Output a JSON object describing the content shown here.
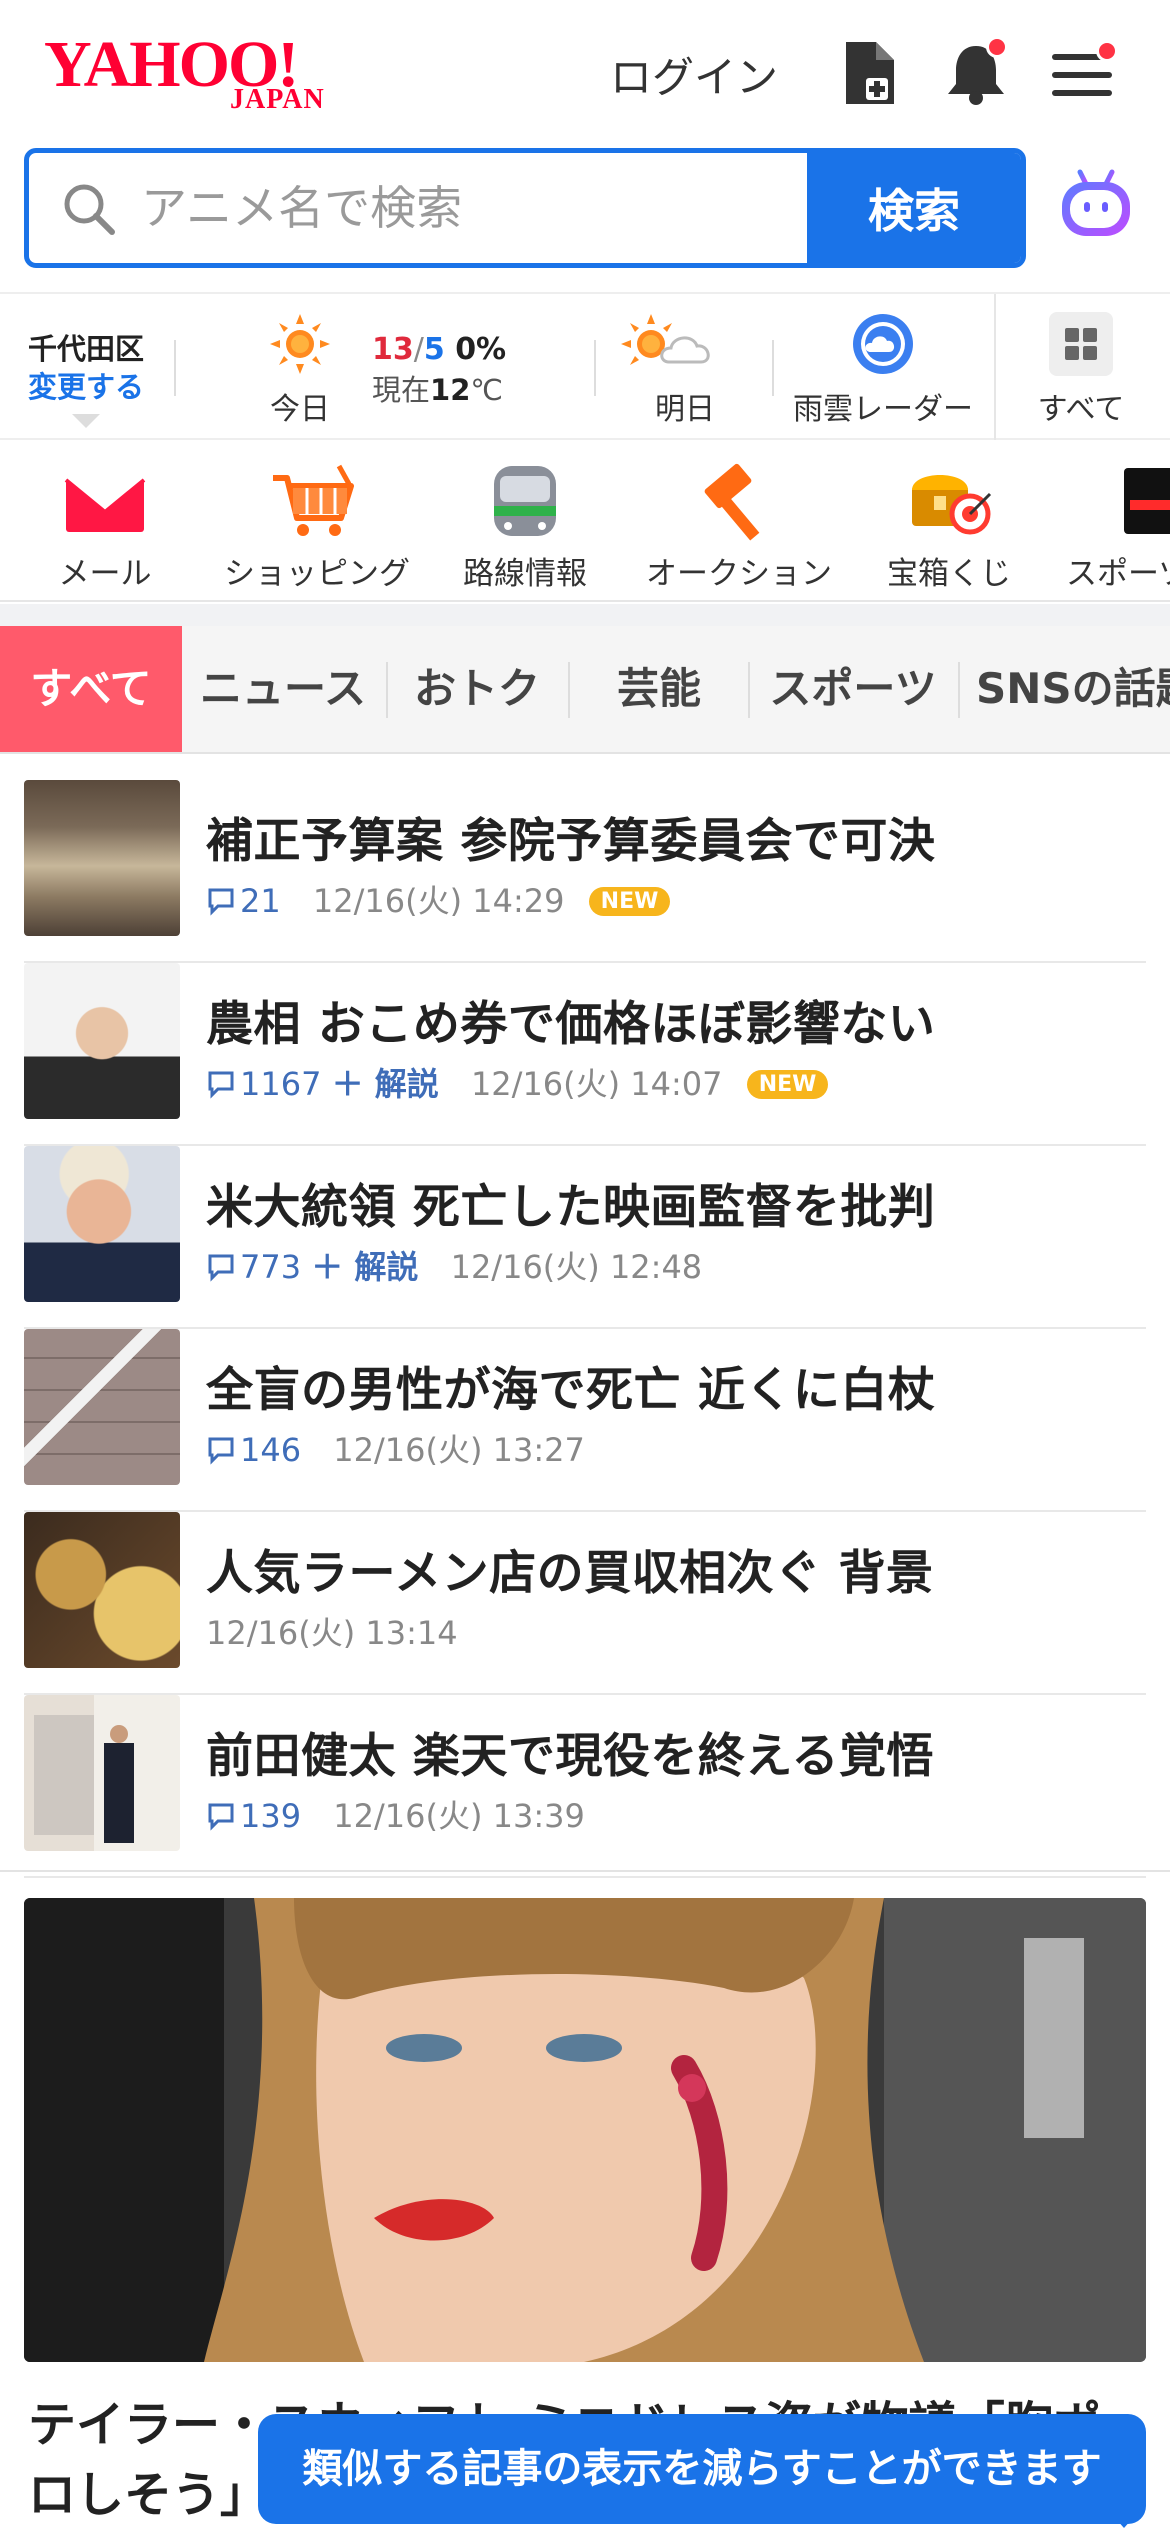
{
  "header": {
    "logo_main": "YAHOO!",
    "logo_sub": "JAPAN",
    "login_label": "ログイン"
  },
  "search": {
    "placeholder": "アニメ名で検索",
    "button_label": "検索"
  },
  "weather": {
    "location": "千代田区",
    "change_label": "変更する",
    "today_label": "今日",
    "high": "13",
    "low": "5",
    "precip": "0%",
    "now_prefix": "現在",
    "now_temp": "12",
    "now_unit": "℃",
    "tomorrow_label": "明日",
    "radar_label": "雨雲レーダー",
    "all_label": "すべて"
  },
  "services": [
    {
      "label": "メール",
      "icon": "mail-icon"
    },
    {
      "label": "ショッピング",
      "icon": "cart-icon"
    },
    {
      "label": "路線情報",
      "icon": "train-icon"
    },
    {
      "label": "オークション",
      "icon": "auction-hammer-icon"
    },
    {
      "label": "宝箱くじ",
      "icon": "treasure-box-icon"
    },
    {
      "label": "スポーツ",
      "icon": "sports-icon"
    }
  ],
  "tabs": [
    "すべて",
    "ニュース",
    "おトク",
    "芸能",
    "スポーツ",
    "SNSの話題"
  ],
  "news": [
    {
      "title": "補正予算案 参院予算委員会で可決",
      "comments": "21",
      "kaisetsu": "",
      "time": "12/16(火) 14:29",
      "badge": "NEW"
    },
    {
      "title": "農相 おこめ券で価格ほぼ影響ない",
      "comments": "1167",
      "kaisetsu": "＋ 解説",
      "time": "12/16(火) 14:07",
      "badge": "NEW"
    },
    {
      "title": "米大統領 死亡した映画監督を批判",
      "comments": "773",
      "kaisetsu": "＋ 解説",
      "time": "12/16(火) 12:48",
      "badge": ""
    },
    {
      "title": "全盲の男性が海で死亡 近くに白杖",
      "comments": "146",
      "kaisetsu": "",
      "time": "12/16(火) 13:27",
      "badge": ""
    },
    {
      "title": "人気ラーメン店の買収相次ぐ 背景",
      "comments": "",
      "kaisetsu": "",
      "time": "12/16(火) 13:14",
      "badge": ""
    },
    {
      "title": "前田健太 楽天で現役を終える覚悟",
      "comments": "139",
      "kaisetsu": "",
      "time": "12/16(火) 13:39",
      "badge": ""
    }
  ],
  "hero": {
    "title": "テイラー・スウィフト ミニドレス姿が物議「胸ポロしそう」"
  },
  "toast": {
    "text": "類似する記事の表示を減らすことができます"
  },
  "colors": {
    "brand_red": "#ff0033",
    "link_blue": "#1a73e8",
    "tab_active": "#ff5a6b",
    "badge_yellow": "#f7b51c"
  }
}
